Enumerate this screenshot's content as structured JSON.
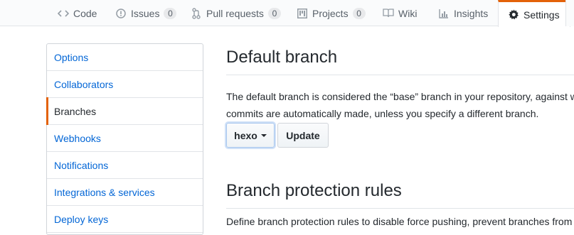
{
  "tabs": [
    {
      "label": "Code",
      "icon": "code-icon"
    },
    {
      "label": "Issues",
      "icon": "issue-opened-icon",
      "count": "0"
    },
    {
      "label": "Pull requests",
      "icon": "git-pull-request-icon",
      "count": "0"
    },
    {
      "label": "Projects",
      "icon": "project-icon",
      "count": "0"
    },
    {
      "label": "Wiki",
      "icon": "book-icon"
    },
    {
      "label": "Insights",
      "icon": "graph-icon"
    },
    {
      "label": "Settings",
      "icon": "gear-icon",
      "selected": true
    }
  ],
  "sidebar": {
    "items": [
      {
        "label": "Options"
      },
      {
        "label": "Collaborators"
      },
      {
        "label": "Branches",
        "selected": true
      },
      {
        "label": "Webhooks"
      },
      {
        "label": "Notifications"
      },
      {
        "label": "Integrations & services"
      },
      {
        "label": "Deploy keys"
      }
    ]
  },
  "default_branch": {
    "title": "Default branch",
    "description_line1": "The default branch is considered the “base” branch in your repository, against w",
    "description_line2": "commits are automatically made, unless you specify a different branch.",
    "branch_select": "hexo",
    "update_button": "Update"
  },
  "protection": {
    "title": "Branch protection rules",
    "description": "Define branch protection rules to disable force pushing, prevent branches from"
  },
  "colors": {
    "accent_orange": "#e36209",
    "link_blue": "#0366d6",
    "border": "#e1e4e8"
  }
}
